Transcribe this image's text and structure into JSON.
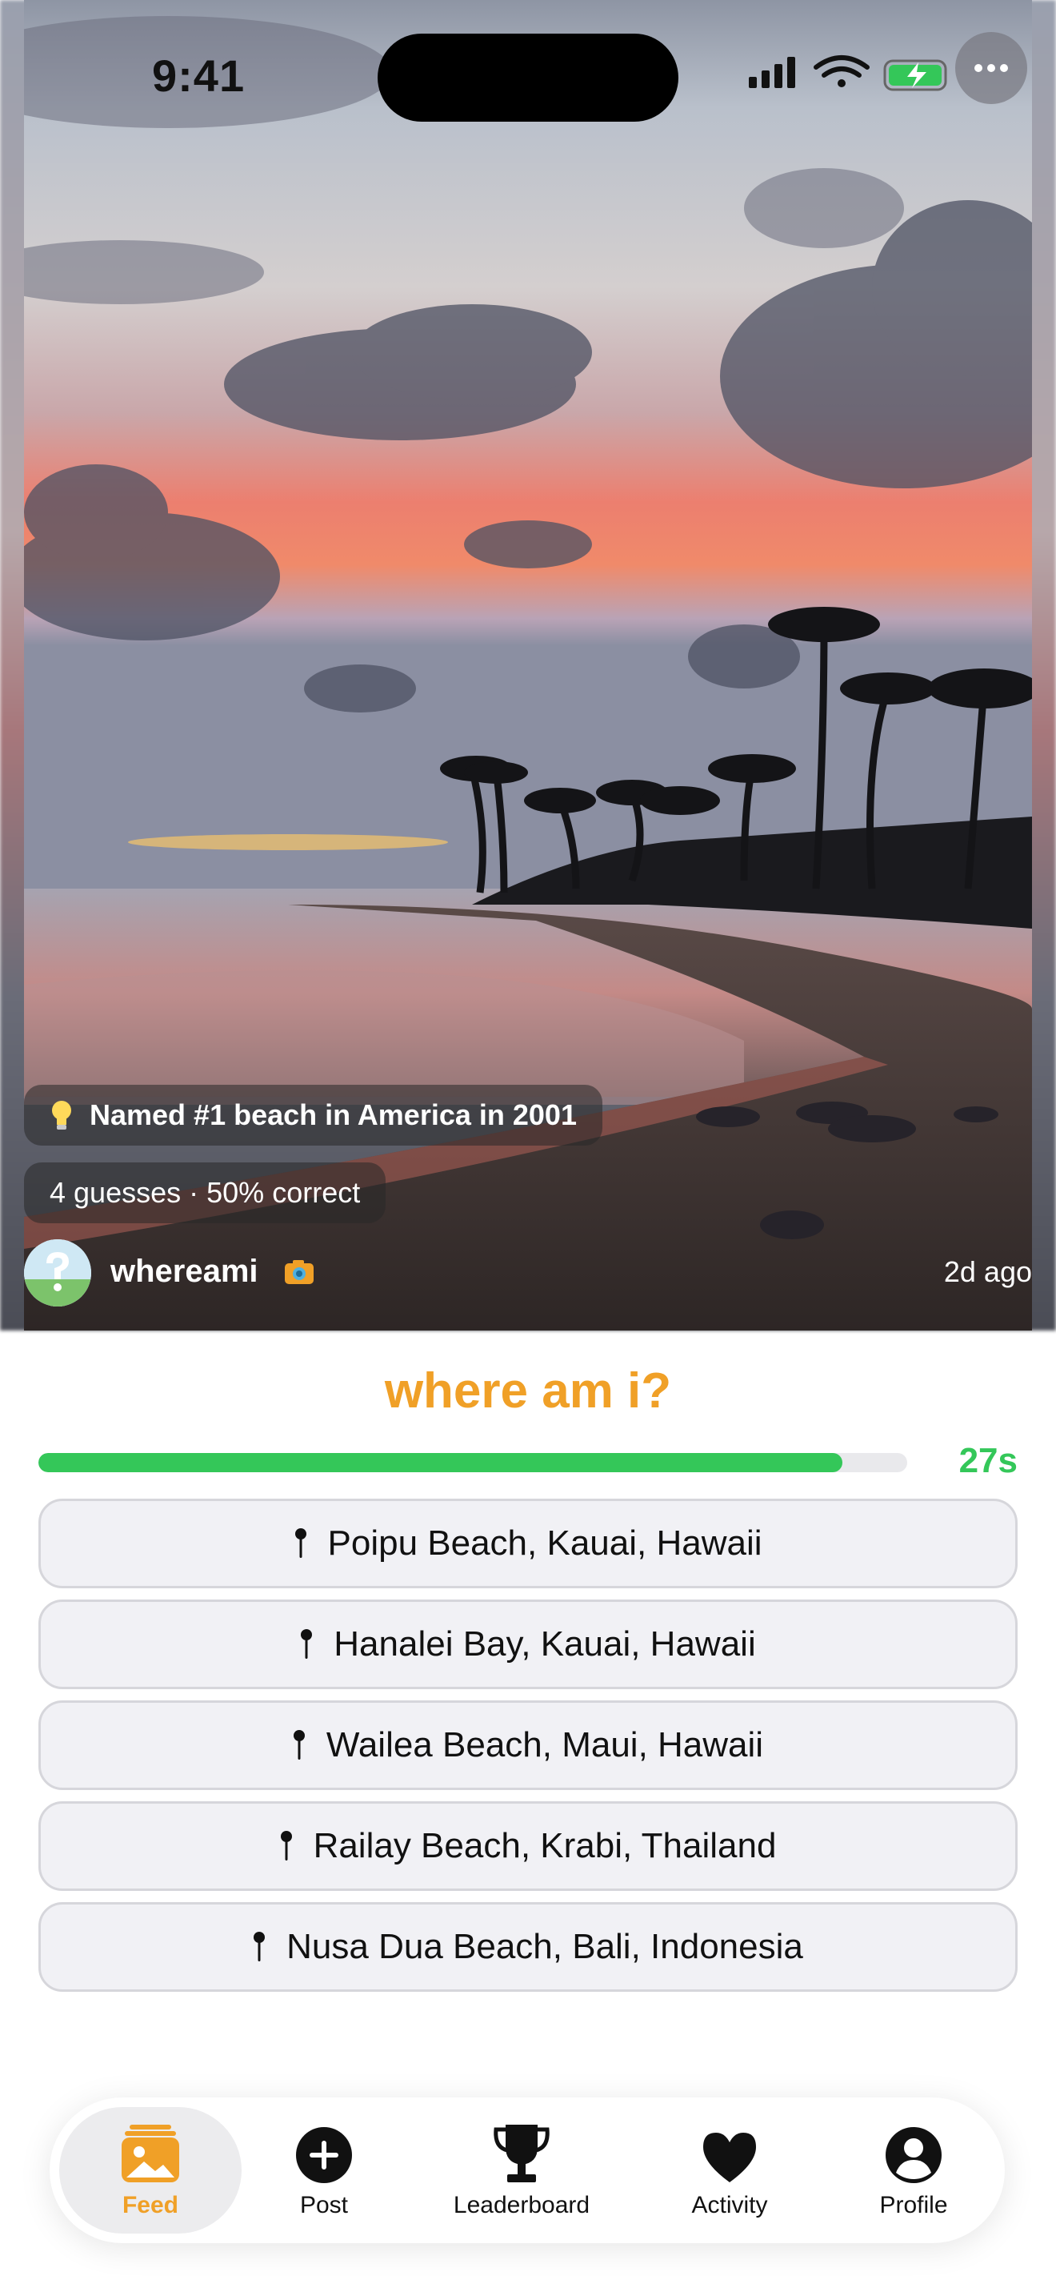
{
  "status_bar": {
    "time": "9:41"
  },
  "post": {
    "hint_text": "Named #1 beach in America in 2001",
    "guess_count": "4 guesses",
    "separator": "·",
    "correct_rate": "50% correct",
    "username": "whereami",
    "time_ago": "2d ago"
  },
  "game": {
    "title": "where am i?",
    "timer_text": "27s",
    "timer_progress": 0.925,
    "options": [
      {
        "label": "Poipu Beach, Kauai, Hawaii"
      },
      {
        "label": "Hanalei Bay, Kauai, Hawaii"
      },
      {
        "label": "Wailea Beach, Maui, Hawaii"
      },
      {
        "label": "Railay Beach, Krabi, Thailand"
      },
      {
        "label": "Nusa Dua Beach, Bali, Indonesia"
      }
    ]
  },
  "tabbar": {
    "items": [
      {
        "label": "Feed",
        "icon": "photo-icon",
        "active": true
      },
      {
        "label": "Post",
        "icon": "plus-circle-icon",
        "active": false
      },
      {
        "label": "Leaderboard",
        "icon": "trophy-icon",
        "active": false
      },
      {
        "label": "Activity",
        "icon": "heart-icon",
        "active": false
      },
      {
        "label": "Profile",
        "icon": "person-circle-icon",
        "active": false
      }
    ]
  },
  "colors": {
    "accent": "#f0a027",
    "timer_green": "#34c759",
    "option_bg": "#f1f1f5"
  }
}
